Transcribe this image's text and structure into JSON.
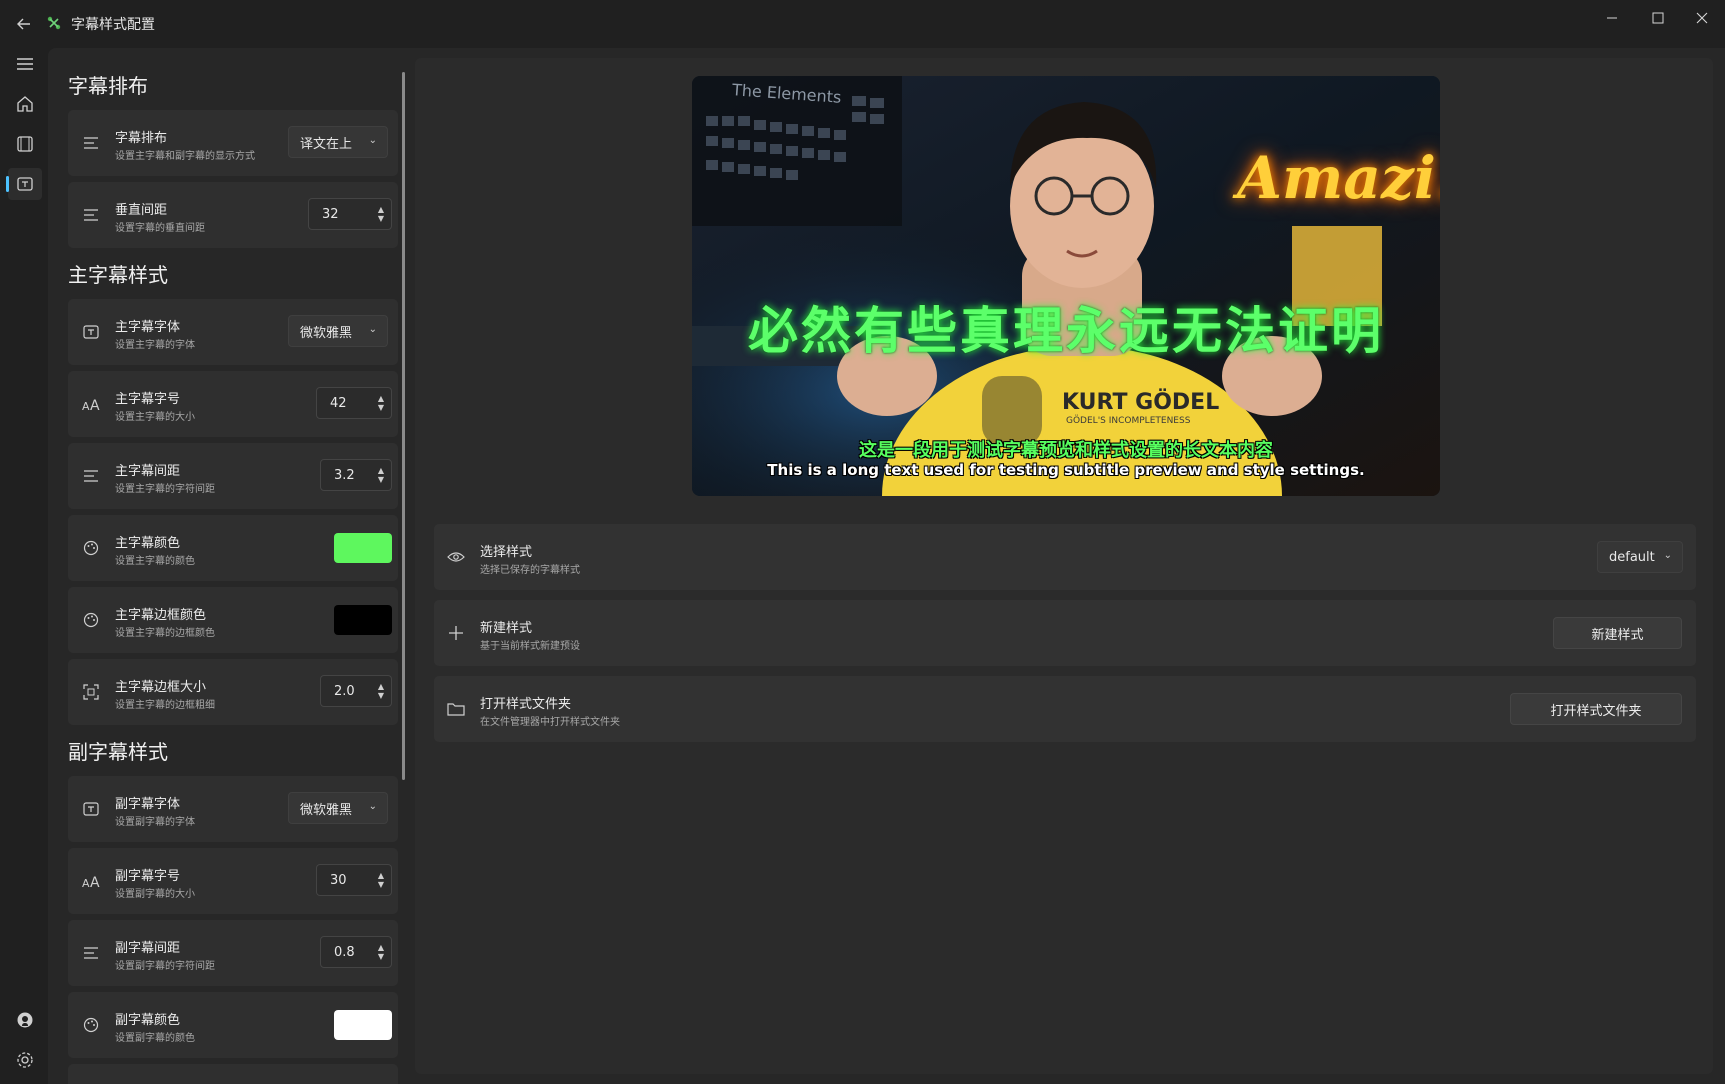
{
  "titlebar": {
    "title": "字幕样式配置",
    "back_icon": "arrow-left-icon",
    "minimize_icon": "minimize-icon",
    "maximize_icon": "maximize-icon",
    "close_icon": "close-icon"
  },
  "nav": {
    "items": [
      "menu-icon",
      "home-icon",
      "film-icon",
      "subtitle-icon"
    ],
    "bottom": [
      "github-icon",
      "settings-icon"
    ],
    "accent": "#4cc2ff"
  },
  "sections": {
    "layout_title": "字幕排布",
    "main_title": "主字幕样式",
    "sub_title": "副字幕样式"
  },
  "settings": {
    "layout": {
      "label": "字幕排布",
      "desc": "设置主字幕和副字幕的显示方式",
      "value": "译文在上"
    },
    "vspace": {
      "label": "垂直间距",
      "desc": "设置字幕的垂直间距",
      "value": "32"
    },
    "main_font": {
      "label": "主字幕字体",
      "desc": "设置主字幕的字体",
      "value": "微软雅黑"
    },
    "main_size": {
      "label": "主字幕字号",
      "desc": "设置主字幕的大小",
      "value": "42"
    },
    "main_spacing": {
      "label": "主字幕间距",
      "desc": "设置主字幕的字符间距",
      "value": "3.2"
    },
    "main_color": {
      "label": "主字幕颜色",
      "desc": "设置主字幕的颜色",
      "value": "#5ef75e"
    },
    "main_border_color": {
      "label": "主字幕边框颜色",
      "desc": "设置主字幕的边框颜色",
      "value": "#000000"
    },
    "main_border_size": {
      "label": "主字幕边框大小",
      "desc": "设置主字幕的边框粗细",
      "value": "2.0"
    },
    "sub_font": {
      "label": "副字幕字体",
      "desc": "设置副字幕的字体",
      "value": "微软雅黑"
    },
    "sub_size": {
      "label": "副字幕字号",
      "desc": "设置副字幕的大小",
      "value": "30"
    },
    "sub_spacing": {
      "label": "副字幕间距",
      "desc": "设置副字幕的字符间距",
      "value": "0.8"
    },
    "sub_color": {
      "label": "副字幕颜色",
      "desc": "设置副字幕的颜色",
      "value": "#ffffff"
    }
  },
  "preview": {
    "big_text": "必然有些真理永远无法证明",
    "line1": "这是一段用于测试字幕预览和样式设置的长文本内容",
    "line2": "This is a long text used for testing subtitle preview and style settings.",
    "sign": "Amazi.n",
    "element_sign": "The Elements",
    "shirt": "KURT GÖDEL",
    "shirt_sub": "GÖDEL'S INCOMPLETENESS"
  },
  "right": {
    "select_style": {
      "label": "选择样式",
      "desc": "选择已保存的字幕样式",
      "value": "default"
    },
    "new_style": {
      "label": "新建样式",
      "desc": "基于当前样式新建预设",
      "button": "新建样式"
    },
    "open_folder": {
      "label": "打开样式文件夹",
      "desc": "在文件管理器中打开样式文件夹",
      "button": "打开样式文件夹"
    }
  }
}
